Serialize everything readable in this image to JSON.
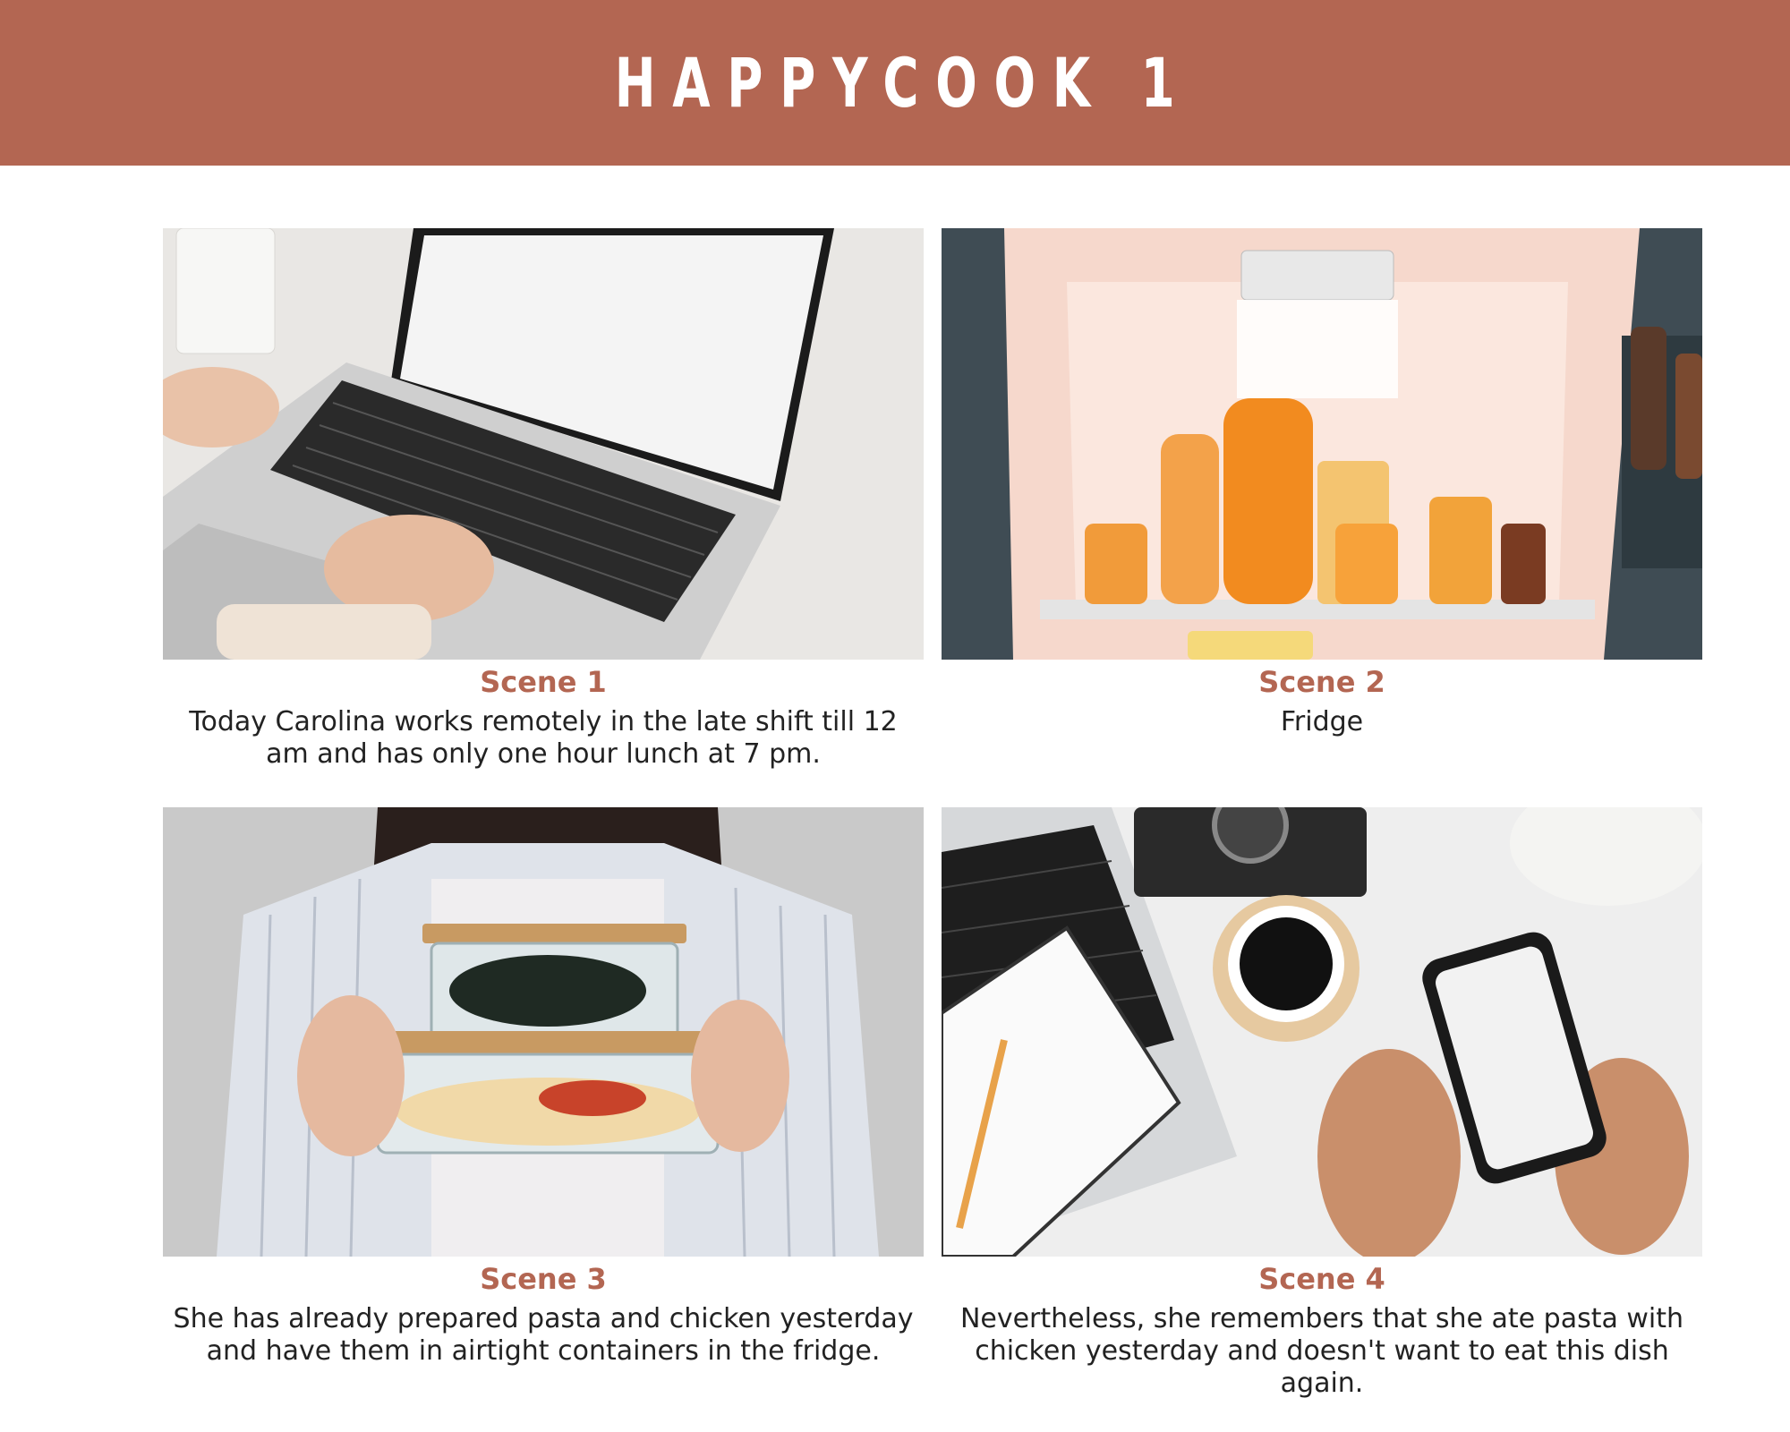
{
  "header": {
    "title": "HAPPYCOOK 1"
  },
  "scenes": [
    {
      "title": "Scene 1",
      "description": "Today Carolina works remotely in the late shift till 12 am and has only one hour lunch at 7 pm."
    },
    {
      "title": "Scene 2",
      "description": "Fridge"
    },
    {
      "title": "Scene 3",
      "description": "She has already prepared pasta and chicken yesterday and have them in airtight containers in the fridge."
    },
    {
      "title": "Scene 4",
      "description": "Nevertheless, she remembers that she ate pasta with chicken yesterday and doesn't want to eat this dish again."
    }
  ],
  "colors": {
    "accent": "#b36652",
    "text": "#222222"
  }
}
